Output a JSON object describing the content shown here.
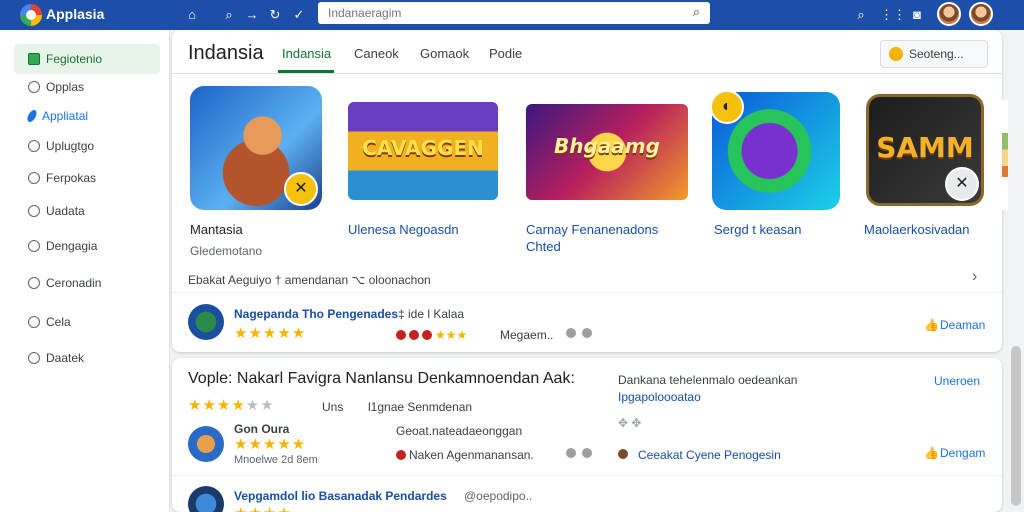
{
  "app": {
    "title": "Applasia"
  },
  "topbar": {
    "search_placeholder": "Indanaeragim",
    "icons": [
      "home-icon",
      "search-icon",
      "forward-icon",
      "redo-icon",
      "check-icon",
      "search-icon",
      "grid-icon",
      "camera-icon"
    ]
  },
  "sidebar": {
    "items": [
      {
        "label": "Fegiotenio",
        "state": "active"
      },
      {
        "label": "Opplas"
      },
      {
        "label": "Appliatal",
        "state": "blue"
      },
      {
        "label": "Uplugtgo"
      },
      {
        "label": "Ferpokas"
      },
      {
        "label": "Uadata"
      },
      {
        "label": "Dengagia"
      },
      {
        "label": "Ceronadin"
      },
      {
        "label": "Cela"
      },
      {
        "label": "Daatek"
      }
    ]
  },
  "main": {
    "page_title": "Indansia",
    "tabs": [
      "Indansia",
      "Caneok",
      "Gomaok",
      "Podie"
    ],
    "active_tab": 0,
    "sort_button": "Seoteng...",
    "tiles": [
      {
        "name": "Mantasia",
        "sub": "Gledemotano",
        "text": ""
      },
      {
        "name": "Ulenesa Negoasdn",
        "sub": "",
        "text": "CAVAGGEN"
      },
      {
        "name": "Carnay Fenanenadons",
        "sub": "Chted",
        "text": "Bhgaamg"
      },
      {
        "name": "Sergd t keasan",
        "sub": "",
        "text": ""
      },
      {
        "name": "Maolaerkosivadan",
        "sub": "",
        "text": "SAMM"
      }
    ],
    "meta_line": "Ebakat Aeguiyo   † amendanan   ⌥ oloonachon",
    "featured_row": {
      "title": "Nagepanda Tho Pengenades",
      "meta": "‡ ide l Kalaa",
      "rating": 5,
      "extra": "Megaem..",
      "action": "Deaman"
    }
  },
  "reviews": {
    "title": "Vople: Nakarl Favigra Nanlansu Denkamnoendan Aak:",
    "rating": 4,
    "rating_label": "Uns",
    "rating_sub": "l1gnae Senmdenan",
    "side_title": "Dankana tehelenmalo oedeankan",
    "side_link": "Ipgapoloooatao",
    "more_button": "Uneroen",
    "item1": {
      "name": "Gon Oura",
      "rating": 5,
      "date": "Mnoelwe 2d 8em",
      "text1": "Geoat.nateadaeonggan",
      "text2": "Naken Agenmanansan.",
      "user": "Ceeakat Cyene Penogesin",
      "action": "Dengam"
    },
    "item2": {
      "name": "Vepgamdol lio Basanadak Pendardes",
      "meta": "@oepodipo.."
    }
  }
}
